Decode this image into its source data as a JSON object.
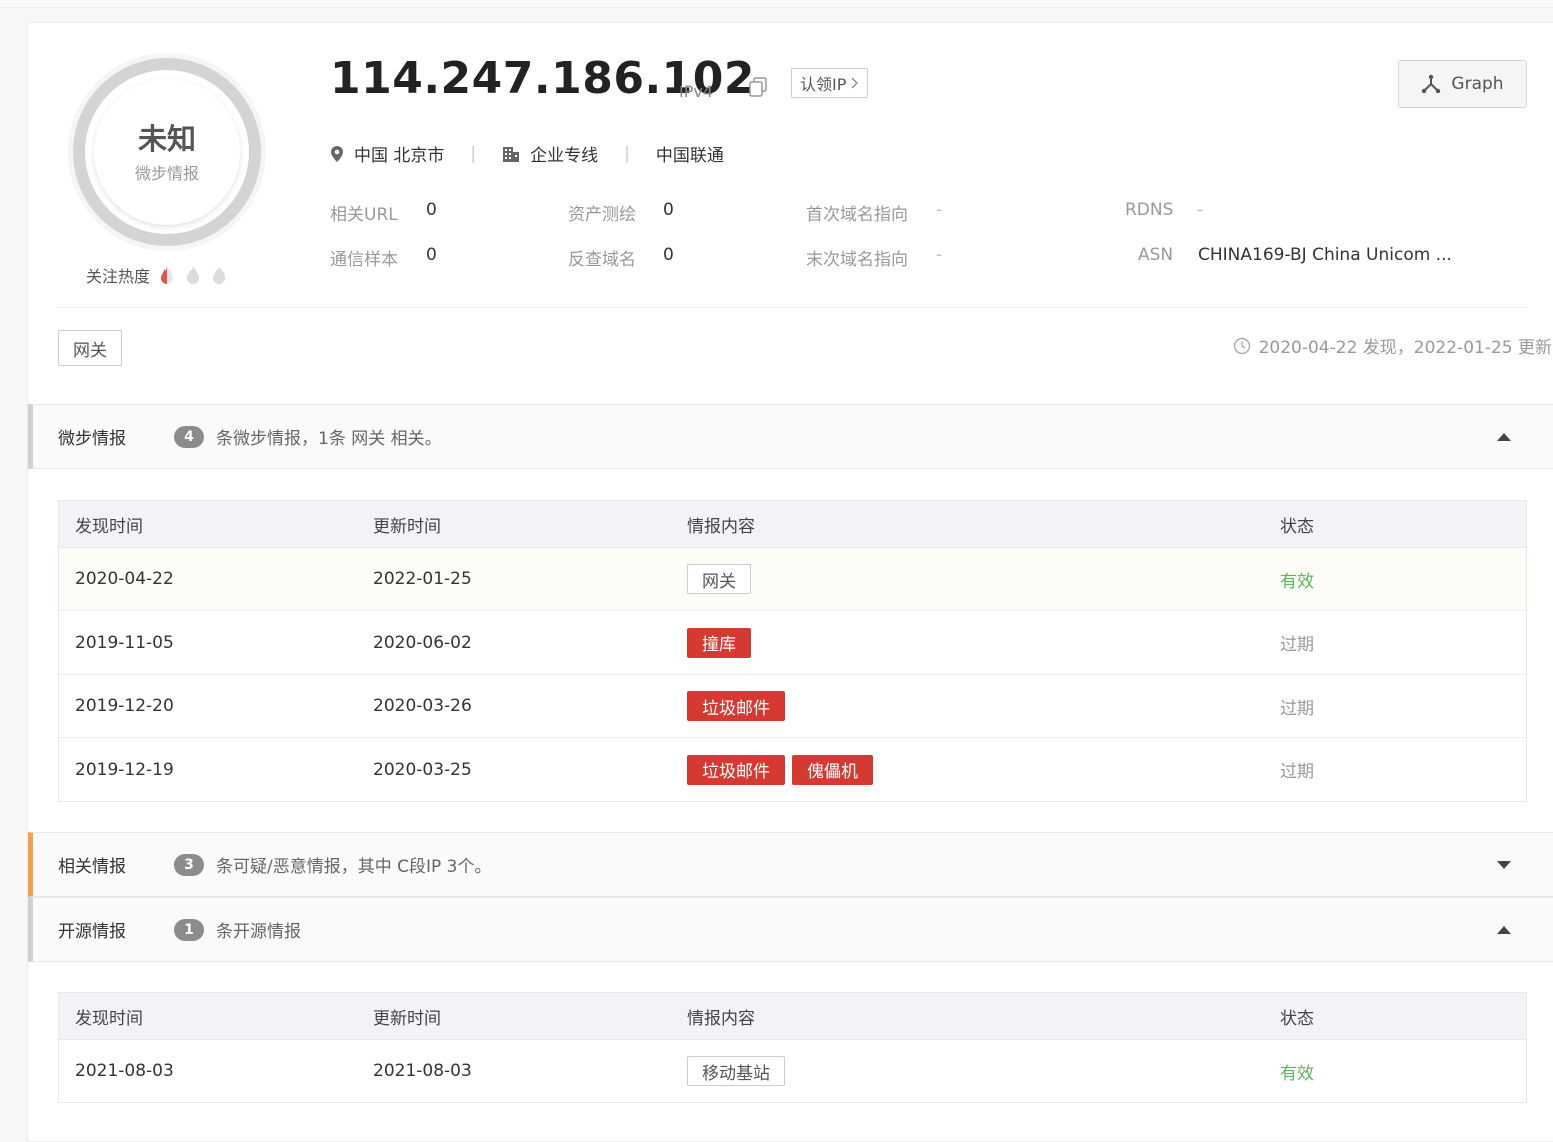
{
  "score": {
    "verdict": "未知",
    "source": "微步情报",
    "heat_label": "关注热度"
  },
  "ip": {
    "address": "114.247.186.102",
    "version": "IPv4",
    "claim_label": "认领IP",
    "graph_label": "Graph"
  },
  "location": {
    "place": "中国 北京市",
    "network_type": "企业专线",
    "isp": "中国联通"
  },
  "meta": {
    "related_url_label": "相关URL",
    "related_url_value": "0",
    "asset_map_label": "资产测绘",
    "asset_map_value": "0",
    "first_domain_label": "首次域名指向",
    "first_domain_value": "-",
    "rdns_label": "RDNS",
    "rdns_value": "-",
    "comm_sample_label": "通信样本",
    "comm_sample_value": "0",
    "reverse_domain_label": "反查域名",
    "reverse_domain_value": "0",
    "last_domain_label": "末次域名指向",
    "last_domain_value": "-",
    "asn_label": "ASN",
    "asn_value": "CHINA169-BJ China Unicom ..."
  },
  "tag": "网关",
  "found_text": "2020-04-22 发现，2022-01-25 更新",
  "sections": {
    "tb": {
      "title": "微步情报",
      "count": "4",
      "desc": "条微步情报，1条 网关 相关。"
    },
    "related": {
      "title": "相关情报",
      "count": "3",
      "desc": "条可疑/恶意情报，其中 C段IP 3个。"
    },
    "open": {
      "title": "开源情报",
      "count": "1",
      "desc": "条开源情报"
    }
  },
  "table_headers": {
    "found": "发现时间",
    "updated": "更新时间",
    "content": "情报内容",
    "status": "状态"
  },
  "tb_rows": [
    {
      "found": "2020-04-22",
      "updated": "2022-01-25",
      "tags": [
        "网关"
      ],
      "status": "有效"
    },
    {
      "found": "2019-11-05",
      "updated": "2020-06-02",
      "tags": [
        "撞库"
      ],
      "status": "过期"
    },
    {
      "found": "2019-12-20",
      "updated": "2020-03-26",
      "tags": [
        "垃圾邮件"
      ],
      "status": "过期"
    },
    {
      "found": "2019-12-19",
      "updated": "2020-03-25",
      "tags": [
        "垃圾邮件",
        "傀儡机"
      ],
      "status": "过期"
    }
  ],
  "open_rows": [
    {
      "found": "2021-08-03",
      "updated": "2021-08-03",
      "tags": [
        "移动基站"
      ],
      "status": "有效"
    }
  ],
  "colors": {
    "tag_red": "#d43a32",
    "status_valid": "#5cb85c",
    "status_expired": "#999999",
    "section_accent_orange": "#f0a050"
  }
}
